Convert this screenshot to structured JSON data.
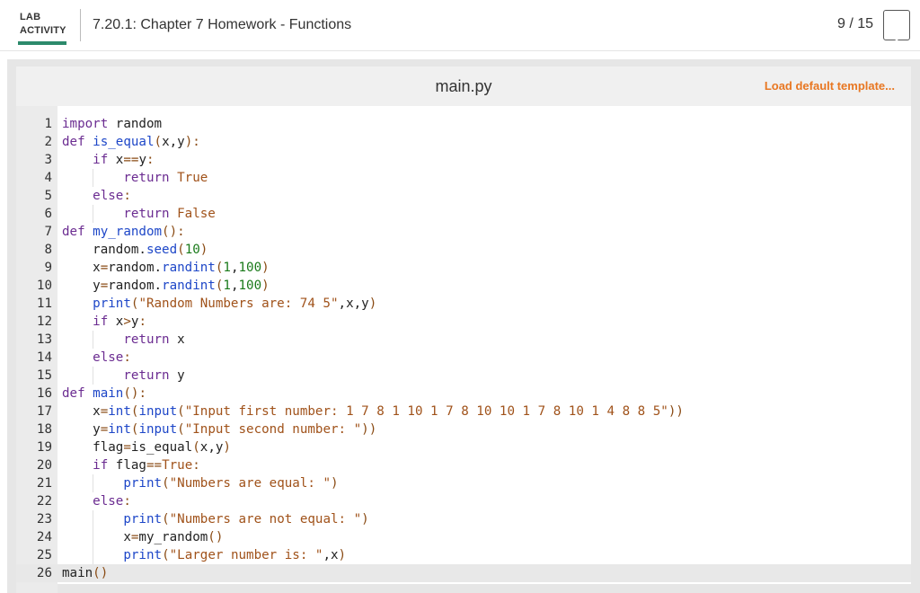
{
  "header": {
    "lab_line1": "LAB",
    "lab_line2": "ACTIVITY",
    "title": "7.20.1: Chapter 7 Homework - Functions",
    "progress": "9 / 15",
    "accent_color": "#2c8a6b"
  },
  "file_bar": {
    "file_name": "main.py",
    "load_template_label": "Load default template...",
    "load_color": "#e87722"
  },
  "code": {
    "lines": [
      [
        [
          "kw",
          "import"
        ],
        [
          "pl",
          " random"
        ]
      ],
      [
        [
          "kw",
          "def"
        ],
        [
          "pl",
          " "
        ],
        [
          "fn",
          "is_equal"
        ],
        [
          "op",
          "("
        ],
        [
          "pl",
          "x,y"
        ],
        [
          "op",
          ")"
        ],
        [
          "op",
          ":"
        ]
      ],
      [
        [
          "pl",
          "    "
        ],
        [
          "kw",
          "if"
        ],
        [
          "pl",
          " x"
        ],
        [
          "op",
          "=="
        ],
        [
          "pl",
          "y"
        ],
        [
          "op",
          ":"
        ]
      ],
      [
        [
          "pl",
          "        "
        ],
        [
          "kw",
          "return"
        ],
        [
          "pl",
          " "
        ],
        [
          "st",
          "True"
        ]
      ],
      [
        [
          "pl",
          "    "
        ],
        [
          "kw",
          "else"
        ],
        [
          "op",
          ":"
        ]
      ],
      [
        [
          "pl",
          "        "
        ],
        [
          "kw",
          "return"
        ],
        [
          "pl",
          " "
        ],
        [
          "st",
          "False"
        ]
      ],
      [
        [
          "kw",
          "def"
        ],
        [
          "pl",
          " "
        ],
        [
          "fn",
          "my_random"
        ],
        [
          "op",
          "()"
        ],
        [
          "op",
          ":"
        ]
      ],
      [
        [
          "pl",
          "    random."
        ],
        [
          "fn",
          "seed"
        ],
        [
          "op",
          "("
        ],
        [
          "nm",
          "10"
        ],
        [
          "op",
          ")"
        ]
      ],
      [
        [
          "pl",
          "    x"
        ],
        [
          "op",
          "="
        ],
        [
          "pl",
          "random."
        ],
        [
          "fn",
          "randint"
        ],
        [
          "op",
          "("
        ],
        [
          "nm",
          "1"
        ],
        [
          "pl",
          ","
        ],
        [
          "nm",
          "100"
        ],
        [
          "op",
          ")"
        ]
      ],
      [
        [
          "pl",
          "    y"
        ],
        [
          "op",
          "="
        ],
        [
          "pl",
          "random."
        ],
        [
          "fn",
          "randint"
        ],
        [
          "op",
          "("
        ],
        [
          "nm",
          "1"
        ],
        [
          "pl",
          ","
        ],
        [
          "nm",
          "100"
        ],
        [
          "op",
          ")"
        ]
      ],
      [
        [
          "pl",
          "    "
        ],
        [
          "fn",
          "print"
        ],
        [
          "op",
          "("
        ],
        [
          "st",
          "\"Random Numbers are: 74 5\""
        ],
        [
          "pl",
          ",x,y"
        ],
        [
          "op",
          ")"
        ]
      ],
      [
        [
          "pl",
          "    "
        ],
        [
          "kw",
          "if"
        ],
        [
          "pl",
          " x"
        ],
        [
          "op",
          ">"
        ],
        [
          "pl",
          "y"
        ],
        [
          "op",
          ":"
        ]
      ],
      [
        [
          "pl",
          "        "
        ],
        [
          "kw",
          "return"
        ],
        [
          "pl",
          " x"
        ]
      ],
      [
        [
          "pl",
          "    "
        ],
        [
          "kw",
          "else"
        ],
        [
          "op",
          ":"
        ]
      ],
      [
        [
          "pl",
          "        "
        ],
        [
          "kw",
          "return"
        ],
        [
          "pl",
          " y"
        ]
      ],
      [
        [
          "kw",
          "def"
        ],
        [
          "pl",
          " "
        ],
        [
          "fn",
          "main"
        ],
        [
          "op",
          "()"
        ],
        [
          "op",
          ":"
        ]
      ],
      [
        [
          "pl",
          "    x"
        ],
        [
          "op",
          "="
        ],
        [
          "fn",
          "int"
        ],
        [
          "op",
          "("
        ],
        [
          "fn",
          "input"
        ],
        [
          "op",
          "("
        ],
        [
          "st",
          "\"Input first number: 1 7 8 1 10 1 7 8 10 10 1 7 8 10 1 4 8 8 5\""
        ],
        [
          "op",
          "))"
        ]
      ],
      [
        [
          "pl",
          "    y"
        ],
        [
          "op",
          "="
        ],
        [
          "fn",
          "int"
        ],
        [
          "op",
          "("
        ],
        [
          "fn",
          "input"
        ],
        [
          "op",
          "("
        ],
        [
          "st",
          "\"Input second number: \""
        ],
        [
          "op",
          "))"
        ]
      ],
      [
        [
          "pl",
          "    flag"
        ],
        [
          "op",
          "="
        ],
        [
          "pl",
          "is_equal"
        ],
        [
          "op",
          "("
        ],
        [
          "pl",
          "x,y"
        ],
        [
          "op",
          ")"
        ]
      ],
      [
        [
          "pl",
          "    "
        ],
        [
          "kw",
          "if"
        ],
        [
          "pl",
          " flag"
        ],
        [
          "op",
          "=="
        ],
        [
          "st",
          "True"
        ],
        [
          "op",
          ":"
        ]
      ],
      [
        [
          "pl",
          "        "
        ],
        [
          "fn",
          "print"
        ],
        [
          "op",
          "("
        ],
        [
          "st",
          "\"Numbers are equal: \""
        ],
        [
          "op",
          ")"
        ]
      ],
      [
        [
          "pl",
          "    "
        ],
        [
          "kw",
          "else"
        ],
        [
          "op",
          ":"
        ]
      ],
      [
        [
          "pl",
          "        "
        ],
        [
          "fn",
          "print"
        ],
        [
          "op",
          "("
        ],
        [
          "st",
          "\"Numbers are not equal: \""
        ],
        [
          "op",
          ")"
        ]
      ],
      [
        [
          "pl",
          "        x"
        ],
        [
          "op",
          "="
        ],
        [
          "pl",
          "my_random"
        ],
        [
          "op",
          "()"
        ]
      ],
      [
        [
          "pl",
          "        "
        ],
        [
          "fn",
          "print"
        ],
        [
          "op",
          "("
        ],
        [
          "st",
          "\"Larger number is: \""
        ],
        [
          "pl",
          ",x"
        ],
        [
          "op",
          ")"
        ]
      ],
      [
        [
          "pl",
          "main"
        ],
        [
          "op",
          "()"
        ]
      ]
    ],
    "active_line": 26
  }
}
